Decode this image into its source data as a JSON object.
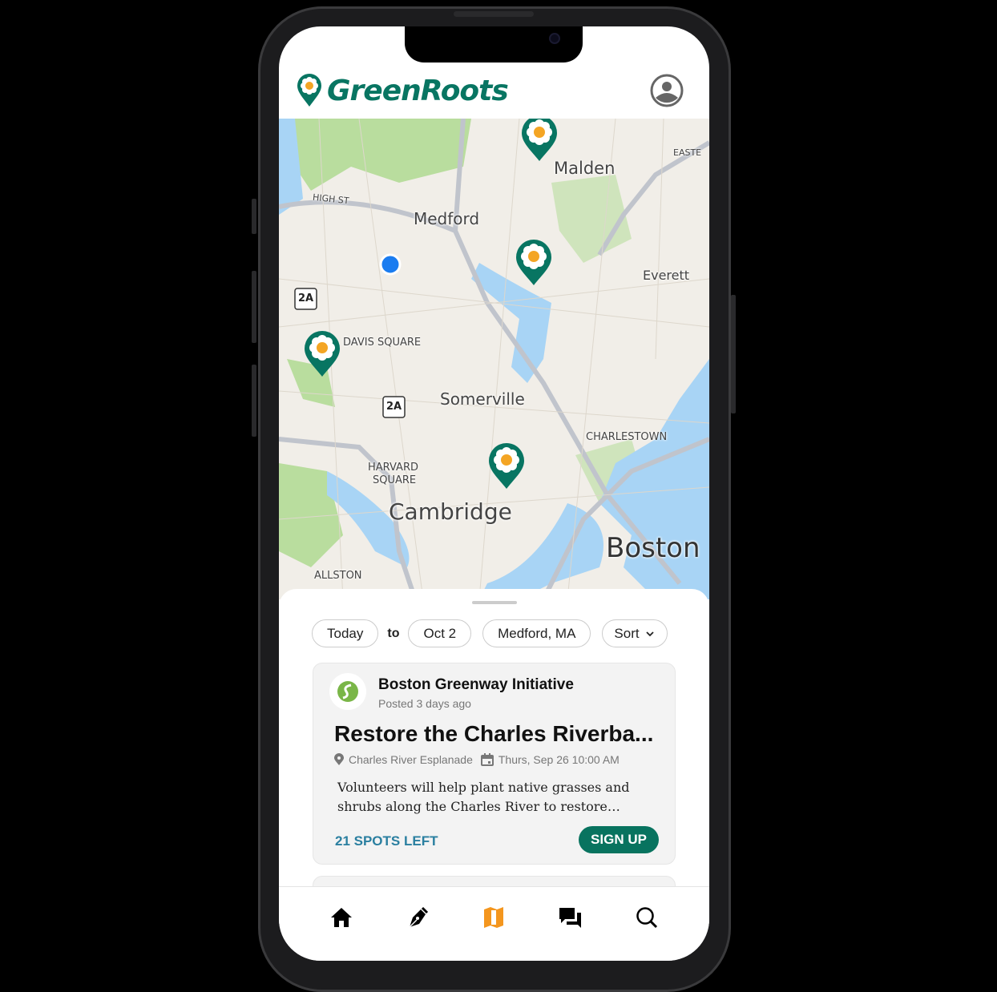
{
  "app": {
    "name": "GreenRoots",
    "brand_color": "#087562",
    "accent_color": "#f4961e"
  },
  "map": {
    "labels": {
      "malden": "Malden",
      "medford": "Medford",
      "everett": "Everett",
      "davis": "DAVIS SQUARE",
      "somerville": "Somerville",
      "charlestown": "CHARLESTOWN",
      "harvard1": "HARVARD",
      "harvard2": "SQUARE",
      "cambridge": "Cambridge",
      "boston": "Boston",
      "allston": "ALLSTON",
      "high_st": "HIGH ST",
      "easte": "EASTE",
      "route_2a": "2A"
    },
    "pins": [
      "flower-pin",
      "flower-pin",
      "flower-pin",
      "flower-pin"
    ],
    "current_location": "blue-dot"
  },
  "filters": {
    "start": "Today",
    "to": "to",
    "end": "Oct 2",
    "location": "Medford, MA",
    "sort": "Sort"
  },
  "card": {
    "org": "Boston Greenway Initiative",
    "posted": "Posted 3 days ago",
    "title": "Restore the Charles Riverba...",
    "location": "Charles River Esplanade",
    "datetime": "Thurs, Sep 26 10:00 AM",
    "description": "Volunteers will help plant native grasses and shrubs along the Charles River to restore…",
    "spots": "21 SPOTS LEFT",
    "signup": "SIGN UP"
  },
  "nav": {
    "items": [
      "home",
      "create",
      "map",
      "messages",
      "search"
    ],
    "active": "map"
  }
}
